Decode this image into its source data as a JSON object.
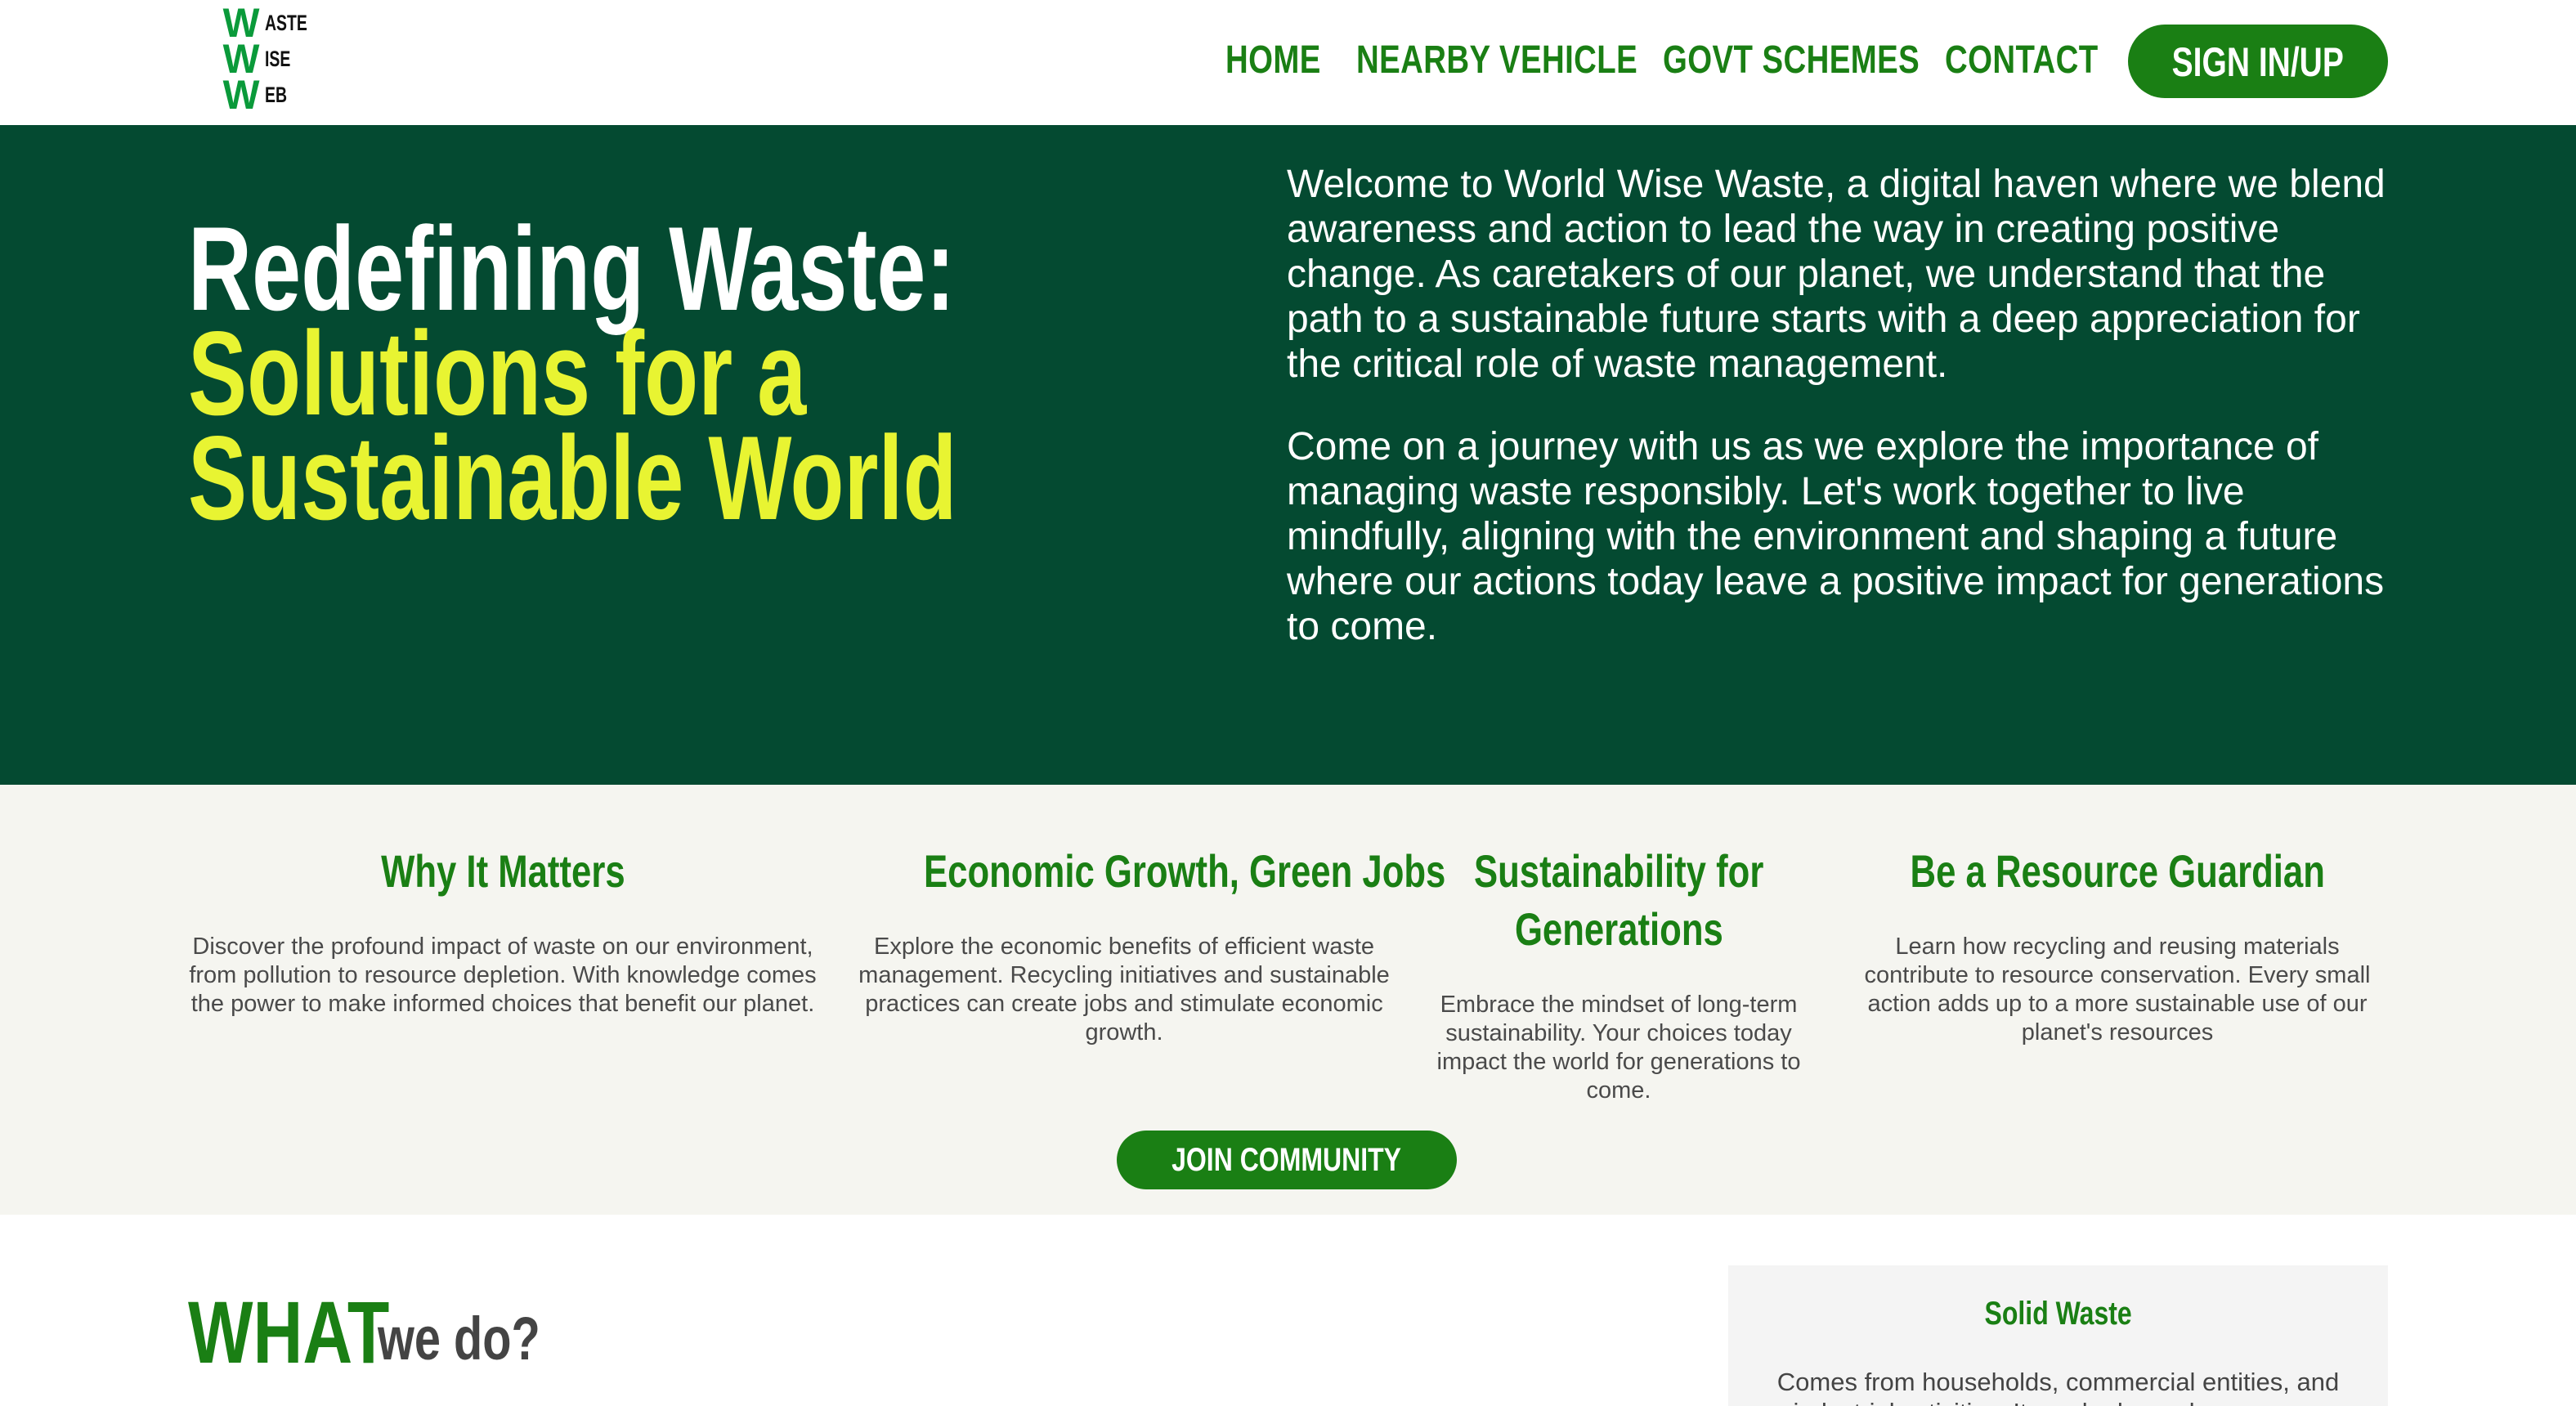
{
  "logo": {
    "rows": [
      {
        "big": "W",
        "small": "ASTE"
      },
      {
        "big": "W",
        "small": "ISE"
      },
      {
        "big": "W",
        "small": "EB"
      }
    ]
  },
  "nav": {
    "items": [
      "HOME",
      "NEARBY VEHICLE",
      "GOVT SCHEMES",
      "CONTACT"
    ],
    "signin_label": "SIGN IN/UP"
  },
  "hero": {
    "title_line1": "Redefining Waste:",
    "title_line2": "Solutions for a",
    "title_line3": "Sustainable World",
    "paragraphs": [
      "Welcome to World Wise Waste, a digital haven where we blend awareness and action to lead the way in creating positive change. As caretakers of our planet, we understand that the path to a sustainable future starts with a deep appreciation for the critical role of waste management.",
      "Come on a journey with us as we explore the importance of managing waste responsibly. Let's work together to live mindfully, aligning with the environment and shaping a future where our actions today leave a positive impact for generations to come."
    ]
  },
  "features": [
    {
      "title": "Why It Matters",
      "text": "Discover the profound impact of waste on our environment, from pollution to resource depletion. With knowledge comes the power to make informed choices that benefit our planet."
    },
    {
      "title": "Economic Growth, Green Jobs",
      "text": "Explore the economic benefits of efficient waste management. Recycling initiatives and sustainable practices can create jobs and stimulate economic growth."
    },
    {
      "title_line1": "Sustainability for",
      "title_line2": "Generations",
      "text": "Embrace the mindset of long-term sustainability. Your choices today impact the world for generations to come."
    },
    {
      "title": "Be a Resource Guardian",
      "text": "Learn how recycling and reusing materials contribute to resource conservation. Every small action adds up to a more sustainable use of our planet's resources"
    }
  ],
  "join_label": "JOIN COMMUNITY",
  "what": {
    "big": "WHAT",
    "small": "we do?"
  },
  "card": {
    "title": "Solid Waste",
    "text": "Comes from households, commercial entities, and industrial activities. It can be hazardous or non-hazardous."
  }
}
